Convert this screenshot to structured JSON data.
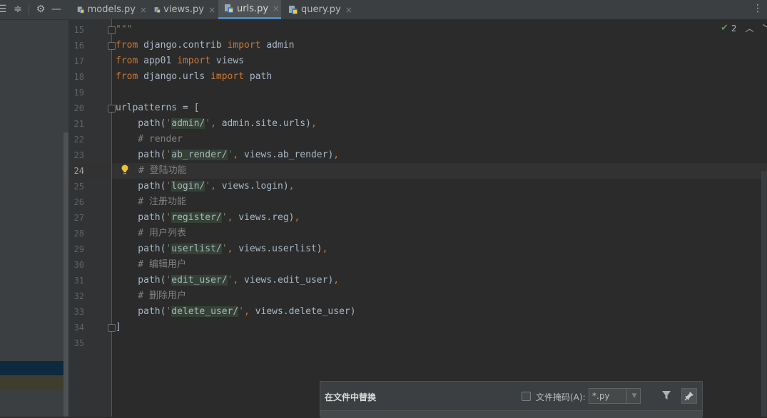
{
  "tabs": [
    {
      "label": "models.py",
      "close": "×"
    },
    {
      "label": "views.py",
      "close": "×"
    },
    {
      "label": "urls.py",
      "close": "×",
      "active": true
    },
    {
      "label": "query.py",
      "close": "×"
    }
  ],
  "colors": {
    "keyword": "#cc7832",
    "string": "#6a8759",
    "comment": "#808080",
    "text": "#a9b7c6",
    "accent": "#4a88c7"
  },
  "inspection": {
    "count": "2"
  },
  "gutter": {
    "l15": "15",
    "l16": "16",
    "l17": "17",
    "l18": "18",
    "l19": "19",
    "l20": "20",
    "l21": "21",
    "l22": "22",
    "l23": "23",
    "l24": "24",
    "l25": "25",
    "l26": "26",
    "l27": "27",
    "l28": "28",
    "l29": "29",
    "l30": "30",
    "l31": "31",
    "l32": "32",
    "l33": "33",
    "l34": "34",
    "l35": "35"
  },
  "code": {
    "l15": "\"\"\"",
    "l16_kw1": "from",
    "l16_a": " django.contrib ",
    "l16_kw2": "import",
    "l16_b": " admin",
    "l17_kw1": "from",
    "l17_a": " app01 ",
    "l17_kw2": "import",
    "l17_b": " views",
    "l18_kw1": "from",
    "l18_a": " django.urls ",
    "l18_kw2": "import",
    "l18_b": " path",
    "l20": "urlpatterns = [",
    "l21_a": "    path(",
    "l21_q1": "'",
    "l21_s": "admin/",
    "l21_q2": "'",
    "l21_c": ",",
    "l21_b": " admin.site.urls)",
    "l21_e": ",",
    "l22": "    # render",
    "l23_a": "    path(",
    "l23_q1": "'",
    "l23_s": "ab_render/",
    "l23_q2": "'",
    "l23_c": ",",
    "l23_b": " views.ab_render)",
    "l23_e": ",",
    "l24": "# 登陆功能",
    "l25_a": "    path(",
    "l25_q1": "'",
    "l25_s": "login/",
    "l25_q2": "'",
    "l25_c": ",",
    "l25_b": " views.login)",
    "l25_e": ",",
    "l26": "    # 注册功能",
    "l27_a": "    path(",
    "l27_q1": "'",
    "l27_s": "register/",
    "l27_q2": "'",
    "l27_c": ",",
    "l27_b": " views.reg)",
    "l27_e": ",",
    "l28": "    # 用户列表",
    "l29_a": "    path(",
    "l29_q1": "'",
    "l29_s": "userlist/",
    "l29_q2": "'",
    "l29_c": ",",
    "l29_b": " views.userlist)",
    "l29_e": ",",
    "l30": "    # 编辑用户",
    "l31_a": "    path(",
    "l31_q1": "'",
    "l31_s": "edit_user/",
    "l31_q2": "'",
    "l31_c": ",",
    "l31_b": " views.edit_user)",
    "l31_e": ",",
    "l32": "    # 删除用户",
    "l33_a": "    path(",
    "l33_q1": "'",
    "l33_s": "delete_user/",
    "l33_q2": "'",
    "l33_c": ",",
    "l33_b": " views.delete_user)",
    "l34": "]"
  },
  "replace_panel": {
    "title": "在文件中替换",
    "mask_label": "文件掩码(A):",
    "mask_value": "*.py"
  }
}
